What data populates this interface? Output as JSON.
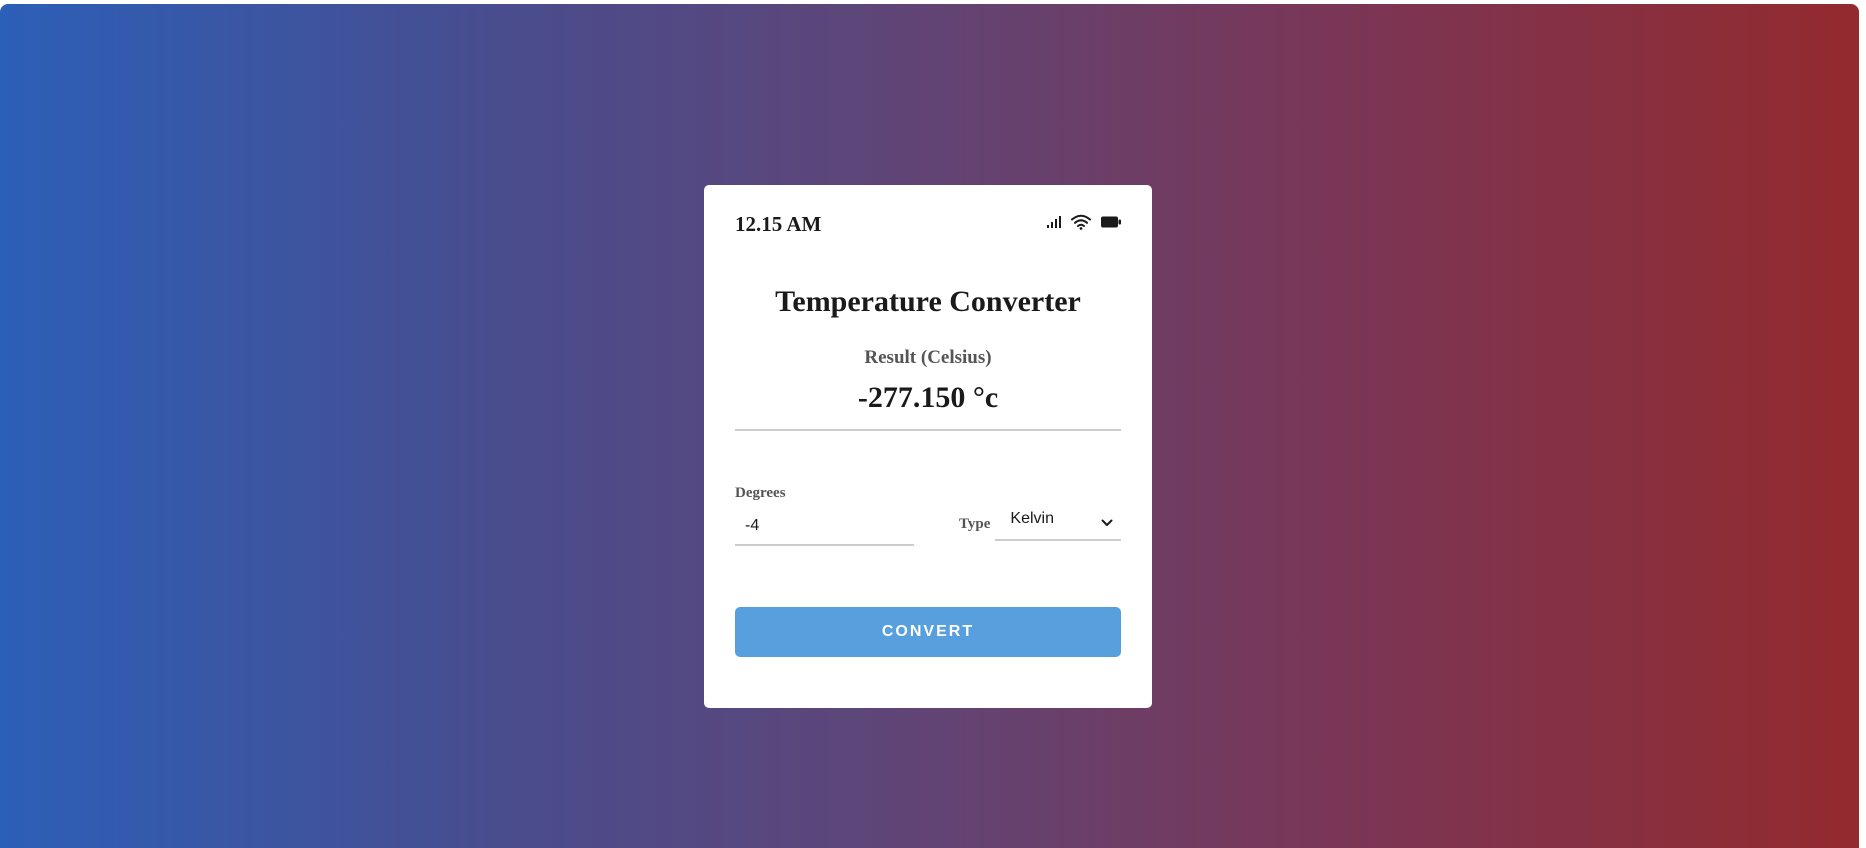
{
  "status_bar": {
    "time": "12.15 AM",
    "icons": [
      "signal-icon",
      "wifi-icon",
      "battery-icon"
    ]
  },
  "converter": {
    "title": "Temperature Converter",
    "result_label": "Result (Celsius)",
    "result_value": "-277.150 °c",
    "degrees_label": "Degrees",
    "degrees_value": "-4",
    "type_label": "Type",
    "type_selected": "Kelvin",
    "convert_label": "CONVERT"
  },
  "colors": {
    "gradient_start": "#2c5fb8",
    "gradient_end": "#932a2e",
    "button": "#58a0dd",
    "card": "#ffffff"
  }
}
